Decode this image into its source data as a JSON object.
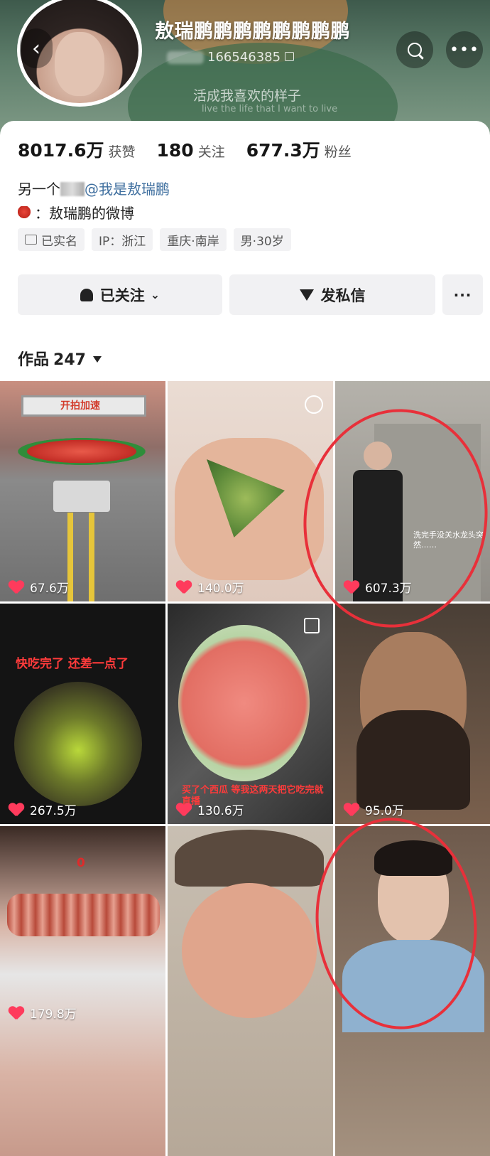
{
  "profile": {
    "name": "敖瑞鹏鹏鹏鹏鹏鹏鹏鹏",
    "id": "166546385",
    "signature": "活成我喜欢的样子",
    "signature_en": "live the life that I want to live"
  },
  "stats": [
    {
      "value": "8017.6万",
      "label": "获赞"
    },
    {
      "value": "180",
      "label": "关注"
    },
    {
      "value": "677.3万",
      "label": "粉丝"
    }
  ],
  "bio": {
    "line1_prefix": "另一个",
    "line1_mention": "@我是敖瑞鹏",
    "line2": "：敖瑞鹏的微博"
  },
  "tags": [
    "已实名",
    "IP：浙江",
    "重庆·南岸",
    "男·30岁"
  ],
  "actions": {
    "follow": "已关注",
    "message": "发私信",
    "more": "···"
  },
  "works": {
    "label": "作品",
    "count": "247"
  },
  "videos": [
    {
      "likes": "67.6万",
      "overlay": "开拍加速"
    },
    {
      "likes": "140.0万",
      "overlay": ""
    },
    {
      "likes": "607.3万",
      "overlay": "洗完手没关水龙头突然……"
    },
    {
      "likes": "267.5万",
      "overlay": "快吃完了 还差一点了"
    },
    {
      "likes": "130.6万",
      "overlay": "买了个西瓜 等我这两天把它吃完就直播"
    },
    {
      "likes": "95.0万",
      "overlay": ""
    },
    {
      "likes": "179.8万",
      "overlay": "0"
    },
    {
      "likes": "",
      "overlay": ""
    },
    {
      "likes": "",
      "overlay": ""
    }
  ],
  "colors": {
    "accent": "#ff3b5c",
    "mention": "#3f6f9f",
    "annotation": "#e8303a"
  }
}
